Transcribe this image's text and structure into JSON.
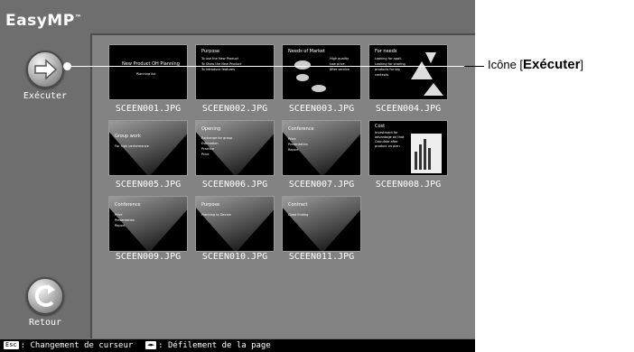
{
  "app": {
    "logo": "EasyMP",
    "trademark": "™"
  },
  "sidebar": {
    "execute_label": "Exécuter",
    "back_label": "Retour"
  },
  "files": [
    {
      "name": "SCEEN001.JPG",
      "slide_title": "New Product OH Planning",
      "bullets": [
        "Planning list"
      ]
    },
    {
      "name": "SCEEN002.JPG",
      "slide_title": "Purpose",
      "bullets": [
        "To use the New Product",
        "To Show the New Product",
        "To Introduce features"
      ]
    },
    {
      "name": "SCEEN003.JPG",
      "slide_title": "Needs of Market",
      "bullets": [
        "High quality",
        "Low price",
        "After service"
      ]
    },
    {
      "name": "SCEEN004.JPG",
      "slide_title": "For needs",
      "bullets": [
        "Looking for appli.",
        "Looking for sharing",
        "products for big",
        "contexts"
      ]
    },
    {
      "name": "SCEEN005.JPG",
      "slide_title": "Group work",
      "bullets": [
        "For high performance"
      ]
    },
    {
      "name": "SCEEN006.JPG",
      "slide_title": "Opening",
      "bullets": [
        "Exchange for group",
        "Estimation",
        "Practice",
        "Price"
      ]
    },
    {
      "name": "SCEEN007.JPG",
      "slide_title": "Conference",
      "bullets": [
        "Price",
        "Presentation",
        "Report"
      ]
    },
    {
      "name": "SCEEN008.JPG",
      "slide_title": "Cost",
      "bullets": [
        "Investment for",
        "advantage on that",
        "Calculate after",
        "product on plan"
      ]
    },
    {
      "name": "SCEEN009.JPG",
      "slide_title": "Conference",
      "bullets": [
        "Price",
        "Presentation",
        "Report"
      ]
    },
    {
      "name": "SCEEN010.JPG",
      "slide_title": "Purpose",
      "bullets": [
        "Planning to Device"
      ]
    },
    {
      "name": "SCEEN011.JPG",
      "slide_title": "Contract",
      "bullets": [
        "Good Ending"
      ]
    }
  ],
  "statusbar": {
    "esc_key": "Esc",
    "esc_text": ": Changement de curseur",
    "arrows_key": "◄►",
    "arrows_text": ": Défilement de la page"
  },
  "callout": {
    "prefix": "Icône [",
    "name": "Exécuter",
    "suffix": "]"
  }
}
